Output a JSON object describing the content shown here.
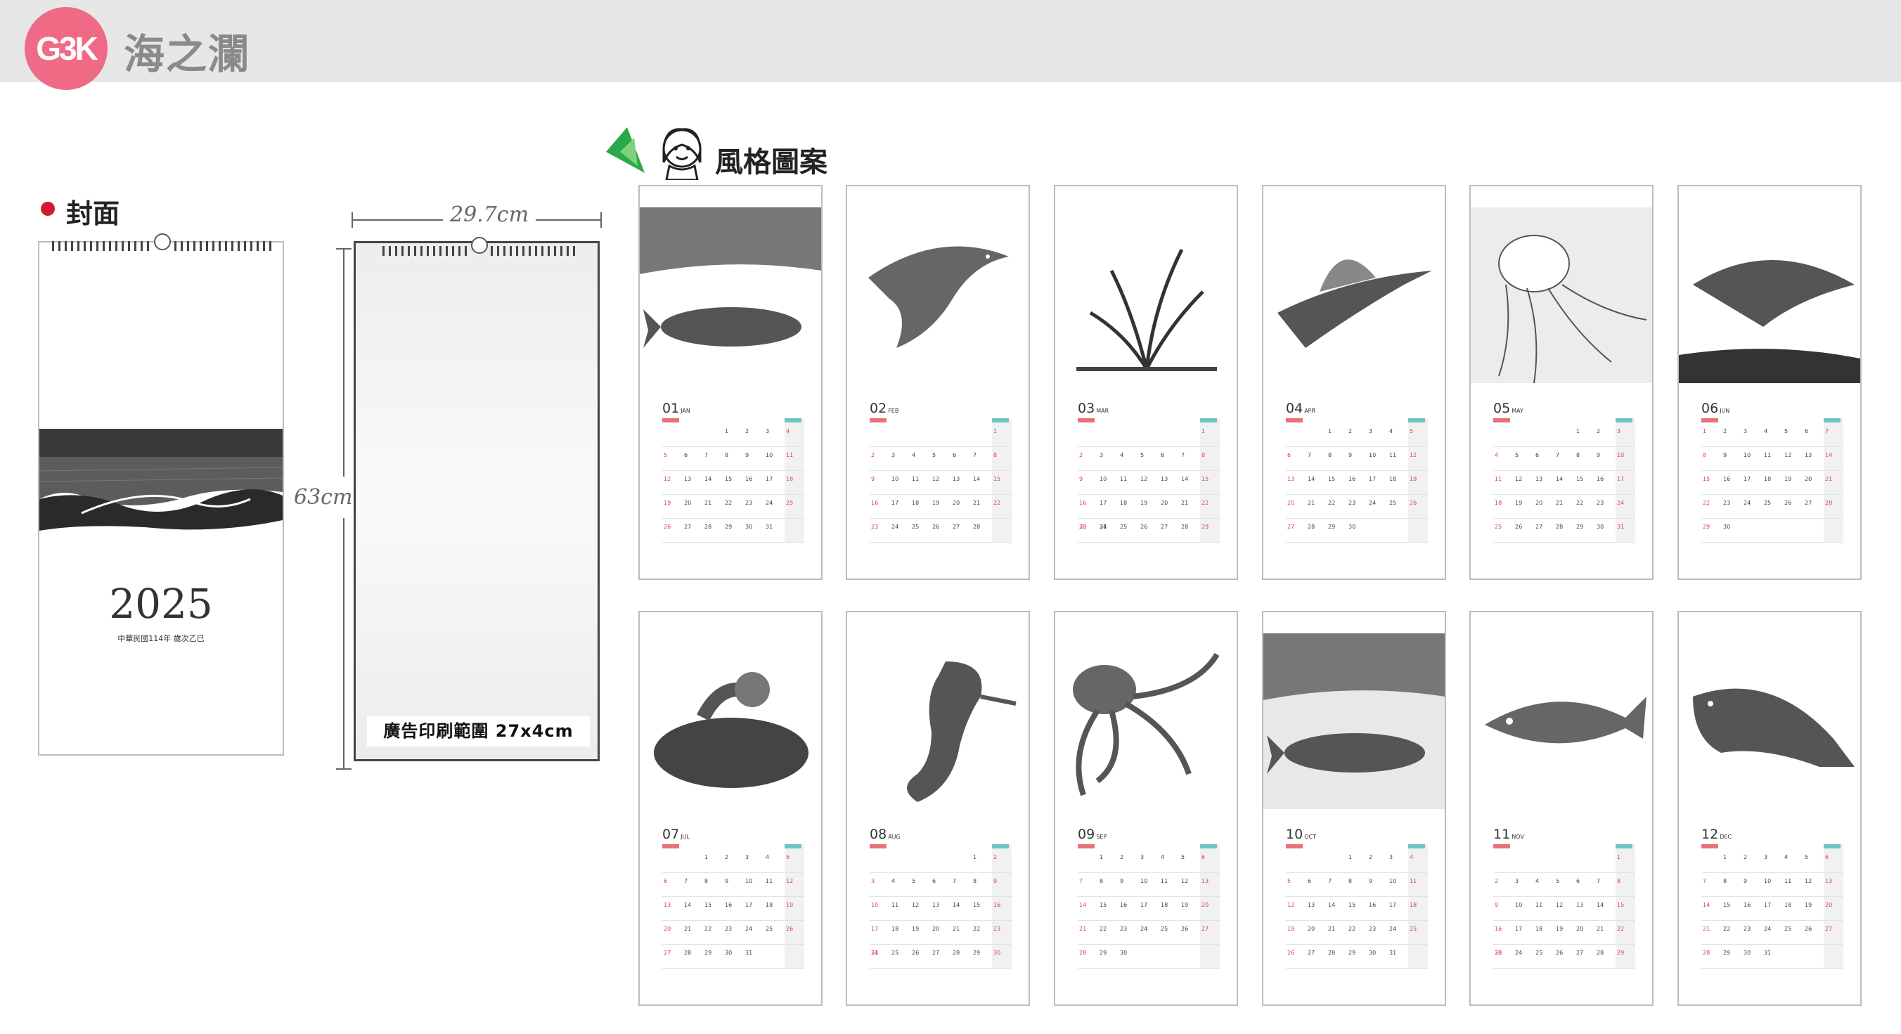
{
  "header": {
    "logo_text": "G3K",
    "brand": "海之瀾"
  },
  "cover_label": "封面",
  "cover": {
    "year": "2025",
    "subtitle": "中華民國114年 歲次乙巳"
  },
  "size": {
    "width": "29.7cm",
    "height": "63cm",
    "ad_area": "廣告印刷範圍 27x4cm"
  },
  "style_label": "風格圖案",
  "colors": {
    "brand_pink": "#ef6b85",
    "sunday_red": "#e8707a",
    "saturday_teal": "#6cc4c4"
  },
  "months": [
    {
      "num": "01",
      "en": "JAN",
      "subject": "whale"
    },
    {
      "num": "02",
      "en": "FEB",
      "subject": "dolphin"
    },
    {
      "num": "03",
      "en": "MAR",
      "subject": "seaweed"
    },
    {
      "num": "04",
      "en": "APR",
      "subject": "sailfish"
    },
    {
      "num": "05",
      "en": "MAY",
      "subject": "jellyfish"
    },
    {
      "num": "06",
      "en": "JUN",
      "subject": "shark"
    },
    {
      "num": "07",
      "en": "JUL",
      "subject": "coral"
    },
    {
      "num": "08",
      "en": "AUG",
      "subject": "seahorse"
    },
    {
      "num": "09",
      "en": "SEP",
      "subject": "octopus"
    },
    {
      "num": "10",
      "en": "OCT",
      "subject": "whale"
    },
    {
      "num": "11",
      "en": "NOV",
      "subject": "fish"
    },
    {
      "num": "12",
      "en": "DEC",
      "subject": "salmon"
    }
  ]
}
